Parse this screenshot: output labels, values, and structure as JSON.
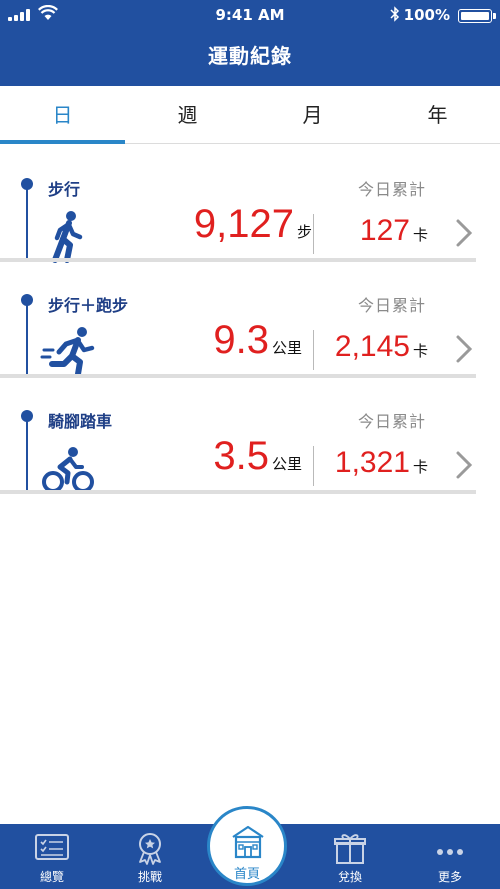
{
  "status_bar": {
    "time": "9:41 AM",
    "battery": "100%"
  },
  "header": {
    "title": "運動紀錄"
  },
  "tabs": [
    {
      "label": "日",
      "active": true
    },
    {
      "label": "週",
      "active": false
    },
    {
      "label": "月",
      "active": false
    },
    {
      "label": "年",
      "active": false
    }
  ],
  "activities": [
    {
      "title": "步行",
      "period": "今日累計",
      "value": "9,127",
      "unit": "步",
      "calories": "127",
      "cal_unit": "卡",
      "icon": "walking-icon"
    },
    {
      "title": "步行＋跑步",
      "period": "今日累計",
      "value": "9.3",
      "unit": "公里",
      "calories": "2,145",
      "cal_unit": "卡",
      "icon": "running-icon"
    },
    {
      "title": "騎腳踏車",
      "period": "今日累計",
      "value": "3.5",
      "unit": "公里",
      "calories": "1,321",
      "cal_unit": "卡",
      "icon": "cycling-icon"
    }
  ],
  "tabbar": {
    "overview": "總覽",
    "challenge": "挑戰",
    "home": "首頁",
    "redeem": "兌換",
    "more": "更多"
  },
  "colors": {
    "brand_blue": "#2150a0",
    "accent": "#2a86c8",
    "value_red": "#e0201f"
  }
}
